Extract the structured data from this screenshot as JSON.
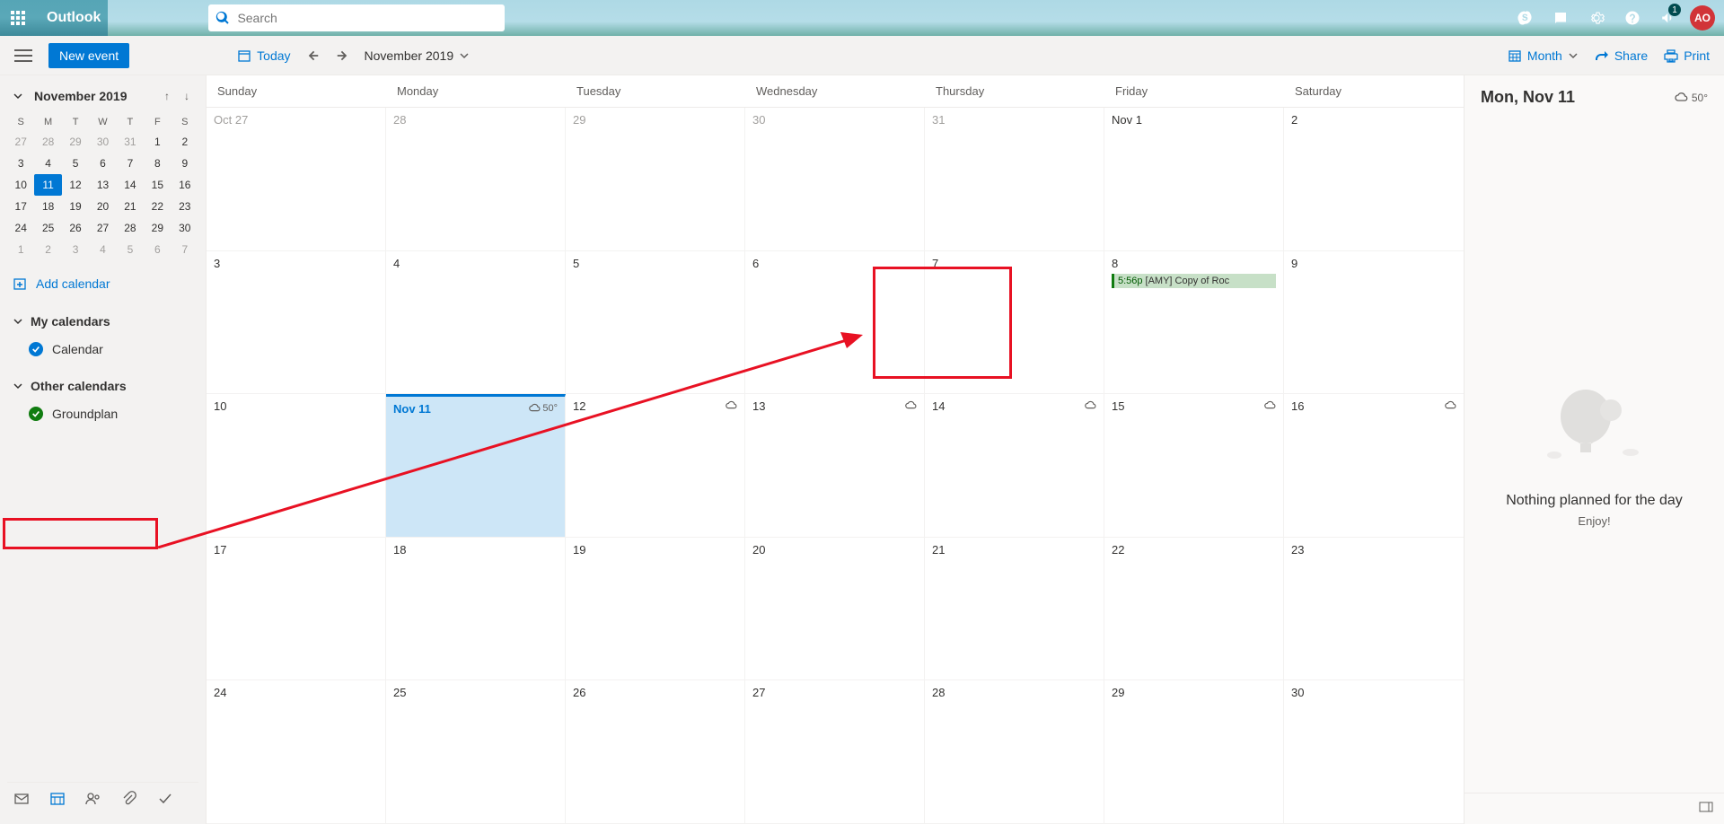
{
  "brand": "Outlook",
  "search": {
    "placeholder": "Search"
  },
  "notif_count": "1",
  "avatar_initials": "AO",
  "toolbar": {
    "new_event": "New event",
    "today": "Today",
    "month_label": "November 2019",
    "view": "Month",
    "share": "Share",
    "print": "Print"
  },
  "mini_cal": {
    "title": "November 2019",
    "dow": [
      "S",
      "M",
      "T",
      "W",
      "T",
      "F",
      "S"
    ],
    "rows": [
      [
        {
          "d": "27",
          "m": true
        },
        {
          "d": "28",
          "m": true
        },
        {
          "d": "29",
          "m": true
        },
        {
          "d": "30",
          "m": true
        },
        {
          "d": "31",
          "m": true
        },
        {
          "d": "1"
        },
        {
          "d": "2"
        }
      ],
      [
        {
          "d": "3"
        },
        {
          "d": "4"
        },
        {
          "d": "5"
        },
        {
          "d": "6"
        },
        {
          "d": "7"
        },
        {
          "d": "8"
        },
        {
          "d": "9"
        }
      ],
      [
        {
          "d": "10"
        },
        {
          "d": "11",
          "sel": true
        },
        {
          "d": "12"
        },
        {
          "d": "13"
        },
        {
          "d": "14"
        },
        {
          "d": "15"
        },
        {
          "d": "16"
        }
      ],
      [
        {
          "d": "17"
        },
        {
          "d": "18"
        },
        {
          "d": "19"
        },
        {
          "d": "20"
        },
        {
          "d": "21"
        },
        {
          "d": "22"
        },
        {
          "d": "23"
        }
      ],
      [
        {
          "d": "24"
        },
        {
          "d": "25"
        },
        {
          "d": "26"
        },
        {
          "d": "27"
        },
        {
          "d": "28"
        },
        {
          "d": "29"
        },
        {
          "d": "30"
        }
      ],
      [
        {
          "d": "1",
          "m": true
        },
        {
          "d": "2",
          "m": true
        },
        {
          "d": "3",
          "m": true
        },
        {
          "d": "4",
          "m": true
        },
        {
          "d": "5",
          "m": true
        },
        {
          "d": "6",
          "m": true
        },
        {
          "d": "7",
          "m": true
        }
      ]
    ]
  },
  "sidebar": {
    "add_calendar": "Add calendar",
    "my_calendars": "My calendars",
    "calendar_item": "Calendar",
    "other_calendars": "Other calendars",
    "groundplan": "Groundplan"
  },
  "grid": {
    "dow": [
      "Sunday",
      "Monday",
      "Tuesday",
      "Wednesday",
      "Thursday",
      "Friday",
      "Saturday"
    ],
    "weeks": [
      [
        {
          "d": "Oct 27",
          "m": true
        },
        {
          "d": "28",
          "m": true
        },
        {
          "d": "29",
          "m": true
        },
        {
          "d": "30",
          "m": true
        },
        {
          "d": "31",
          "m": true
        },
        {
          "d": "Nov 1"
        },
        {
          "d": "2"
        }
      ],
      [
        {
          "d": "3"
        },
        {
          "d": "4"
        },
        {
          "d": "5"
        },
        {
          "d": "6"
        },
        {
          "d": "7"
        },
        {
          "d": "8",
          "ev": {
            "time": "5:56p",
            "title": "[AMY] Copy of Roc"
          }
        },
        {
          "d": "9"
        }
      ],
      [
        {
          "d": "10"
        },
        {
          "d": "Nov 11",
          "today": true,
          "temp": "50°"
        },
        {
          "d": "12",
          "w": true
        },
        {
          "d": "13",
          "w": true
        },
        {
          "d": "14",
          "w": true
        },
        {
          "d": "15",
          "w": true
        },
        {
          "d": "16",
          "w": true
        }
      ],
      [
        {
          "d": "17"
        },
        {
          "d": "18"
        },
        {
          "d": "19"
        },
        {
          "d": "20"
        },
        {
          "d": "21"
        },
        {
          "d": "22"
        },
        {
          "d": "23"
        }
      ],
      [
        {
          "d": "24"
        },
        {
          "d": "25"
        },
        {
          "d": "26"
        },
        {
          "d": "27"
        },
        {
          "d": "28"
        },
        {
          "d": "29"
        },
        {
          "d": "30"
        }
      ]
    ]
  },
  "right_panel": {
    "title": "Mon, Nov 11",
    "temp": "50°",
    "empty_title": "Nothing planned for the day",
    "empty_sub": "Enjoy!"
  }
}
